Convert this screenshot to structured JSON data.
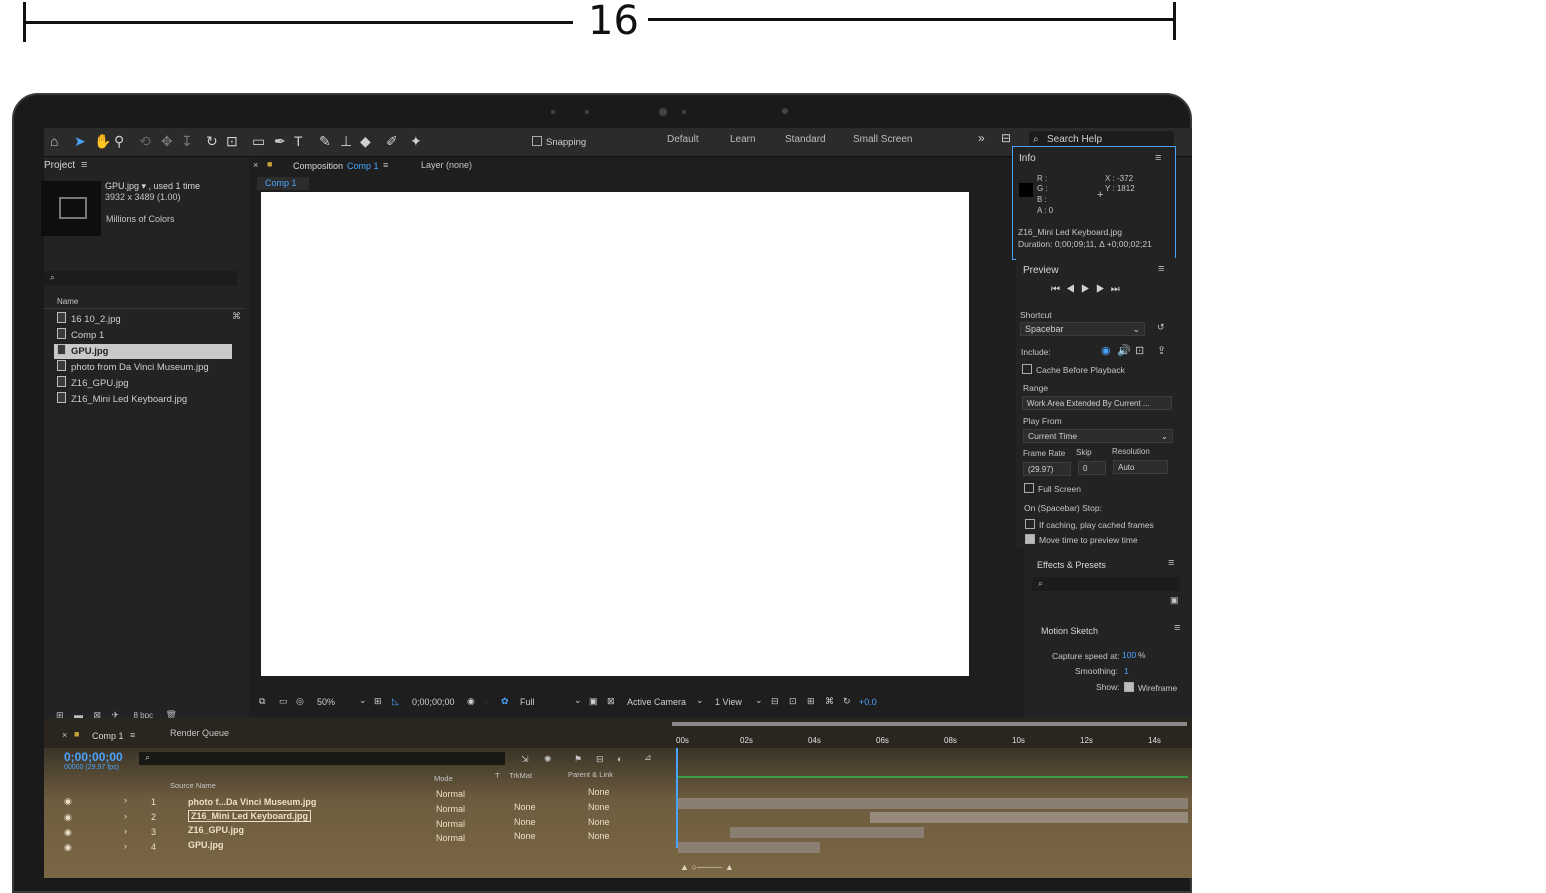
{
  "dimension": {
    "value": "16"
  },
  "toolbar": {
    "snapping_label": "Snapping",
    "workspaces": [
      "Default",
      "Learn",
      "Standard",
      "Small Screen"
    ],
    "search_placeholder": "Search Help"
  },
  "project": {
    "title": "Project",
    "selected_name": "GPU.jpg ▾ , used 1 time",
    "selected_dims": "3932 x 3489 (1.00)",
    "selected_color": "Millions of Colors",
    "column_name": "Name",
    "items": [
      "16 10_2.jpg",
      "Comp 1",
      "GPU.jpg",
      "photo from Da Vinci Museum.jpg",
      "Z16_GPU.jpg",
      "Z16_Mini Led Keyboard.jpg"
    ],
    "bpc": "8 bpc"
  },
  "viewer": {
    "tab_label": "Composition",
    "tab_comp": "Comp 1",
    "layer_label": "Layer (none)",
    "comp_tab": "Comp 1",
    "zoom": "50%",
    "timecode": "0;00;00;00",
    "resolution": "Full",
    "camera": "Active Camera",
    "views": "1 View",
    "exposure": "+0.0"
  },
  "info": {
    "title": "Info",
    "r": "R :",
    "g": "G :",
    "b": "B :",
    "a": "A :  0",
    "x": "X : -372",
    "y": "Y : 1812",
    "file": "Z16_Mini Led Keyboard.jpg",
    "duration": "Duration: 0;00;09;11, Δ +0;00;02;21"
  },
  "preview": {
    "title": "Preview",
    "shortcut_label": "Shortcut",
    "shortcut_value": "Spacebar",
    "include_label": "Include:",
    "cache_label": "Cache Before Playback",
    "range_label": "Range",
    "range_value": "Work Area Extended By Current ...",
    "play_from_label": "Play From",
    "play_from_value": "Current Time",
    "frame_rate_label": "Frame Rate",
    "skip_label": "Skip",
    "resolution_label": "Resolution",
    "frame_rate_value": "(29.97)",
    "skip_value": "0",
    "resolution_value": "Auto",
    "full_screen_label": "Full Screen",
    "stop_label": "On (Spacebar) Stop:",
    "if_caching_label": "If caching, play cached frames",
    "move_time_label": "Move time to preview time"
  },
  "effects": {
    "title": "Effects & Presets"
  },
  "motion_sketch": {
    "title": "Motion Sketch",
    "capture_label": "Capture speed at:",
    "capture_value": "100",
    "capture_unit": "%",
    "smoothing_label": "Smoothing:",
    "smoothing_value": "1",
    "show_label": "Show:",
    "wireframe_label": "Wireframe"
  },
  "timeline": {
    "comp_tab": "Comp 1",
    "render_queue": "Render Queue",
    "timecode": "0;00;00;00",
    "fps": "00000 (29.97 fps)",
    "col_source": "Source Name",
    "col_mode": "Mode",
    "col_t": "T",
    "col_trkmat": "TrkMat",
    "col_parent": "Parent & Link",
    "ticks": [
      "00s",
      "02s",
      "04s",
      "06s",
      "08s",
      "10s",
      "12s",
      "14s"
    ],
    "layers": [
      {
        "num": "1",
        "name": "photo f...Da Vinci Museum.jpg",
        "mode": "Normal",
        "trkmat": "",
        "parent": "None"
      },
      {
        "num": "2",
        "name": "Z16_Mini Led Keyboard.jpg",
        "mode": "Normal",
        "trkmat": "None",
        "parent": "None"
      },
      {
        "num": "3",
        "name": "Z16_GPU.jpg",
        "mode": "Normal",
        "trkmat": "None",
        "parent": "None"
      },
      {
        "num": "4",
        "name": "GPU.jpg",
        "mode": "Normal",
        "trkmat": "None",
        "parent": "None"
      }
    ]
  }
}
